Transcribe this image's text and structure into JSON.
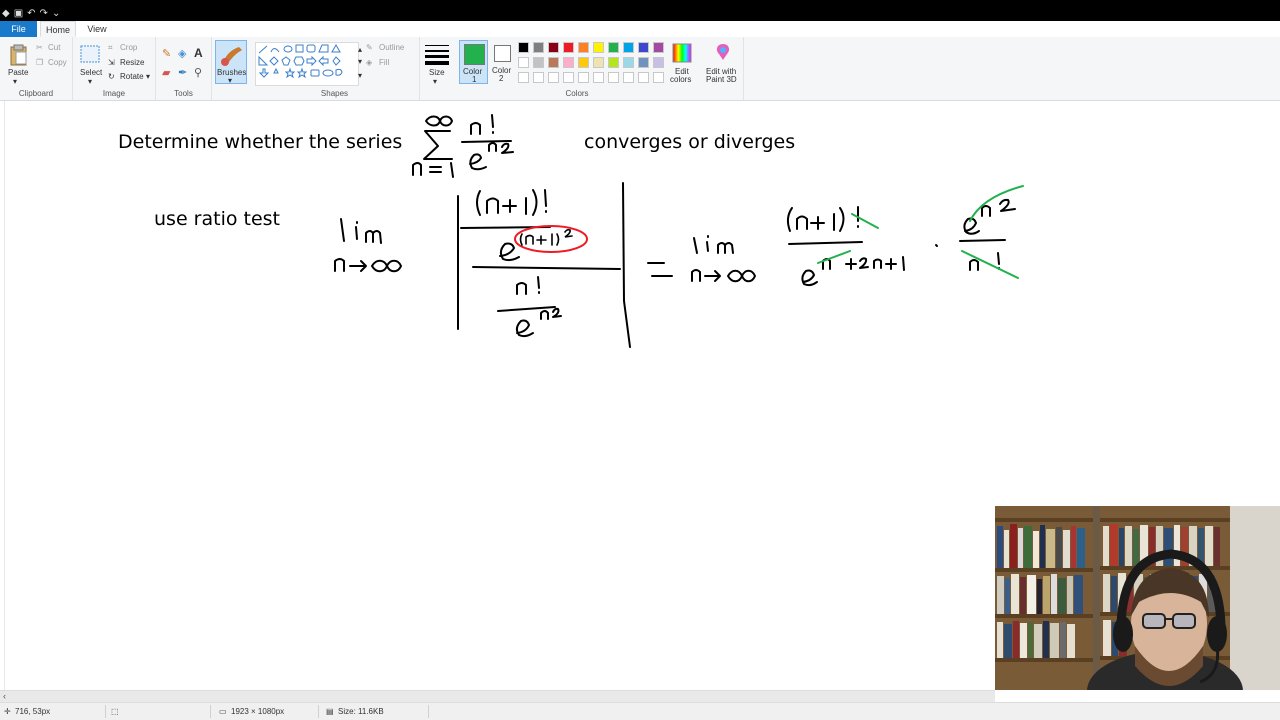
{
  "ribbon_tabs": {
    "file": "File",
    "home": "Home",
    "view": "View"
  },
  "clipboard": {
    "paste": "Paste",
    "cut": "Cut",
    "copy": "Copy",
    "group": "Clipboard"
  },
  "image": {
    "select": "Select",
    "crop": "Crop",
    "resize": "Resize",
    "rotate": "Rotate",
    "group": "Image"
  },
  "tools": {
    "group": "Tools",
    "brushes": "Brushes"
  },
  "shapes": {
    "outline": "Outline",
    "fill": "Fill",
    "group": "Shapes"
  },
  "size": {
    "label": "Size"
  },
  "colors": {
    "color1_line1": "Color",
    "color1_line2": "1",
    "color2_line1": "Color",
    "color2_line2": "2",
    "edit_colors_line1": "Edit",
    "edit_colors_line2": "colors",
    "paint3d_line1": "Edit with",
    "paint3d_line2": "Paint 3D",
    "group": "Colors",
    "color1_value": "#22b14c",
    "color2_value": "#ffffff",
    "palette_row1": [
      "#000000",
      "#7f7f7f",
      "#880015",
      "#ed1c24",
      "#ff7f27",
      "#fff200",
      "#22b14c",
      "#00a2e8",
      "#3f48cc",
      "#a349a4"
    ],
    "palette_row2": [
      "#ffffff",
      "#c3c3c3",
      "#b97a57",
      "#ffaec9",
      "#ffc90e",
      "#efe4b0",
      "#b5e61d",
      "#99d9ea",
      "#7092be",
      "#c8bfe7"
    ]
  },
  "canvas": {
    "question_prefix": "Determine whether the series",
    "question_suffix": "converges or diverges",
    "method": "use ratio test",
    "handwriting": {
      "series_numerator": "n!",
      "series_denominator": "e^(n^2)",
      "series_lower": "n=1",
      "series_upper": "∞",
      "limit_text": "lim",
      "limit_sub": "n→∞",
      "ratio_top_num": "(n+1)!",
      "ratio_top_den": "e^((n+1)^2)",
      "ratio_bot_num": "n!",
      "ratio_bot_den": "e^(n^2)",
      "equals": "=",
      "rhs_num1": "(n+1)!",
      "rhs_den1": "e^(n^2+2n+1)",
      "rhs_num2": "e^(n^2)",
      "rhs_den2": "n!"
    }
  },
  "status": {
    "cursor_pos": "716, 53px",
    "dimensions": "1923 × 1080px",
    "size": "Size: 11.6KB"
  }
}
